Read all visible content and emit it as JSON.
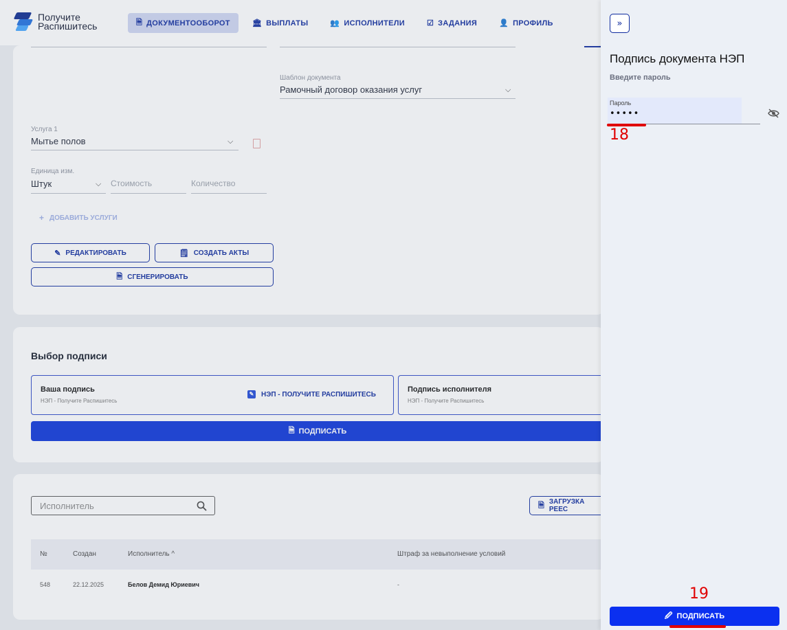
{
  "brand": {
    "line1": "Получите",
    "line2": "Распишитесь"
  },
  "nav": [
    {
      "label": "ДОКУМЕНТООБОРОТ",
      "icon": "document-icon",
      "active": true
    },
    {
      "label": "ВЫПЛАТЫ",
      "icon": "bank-icon",
      "active": false
    },
    {
      "label": "ИСПОЛНИТЕЛИ",
      "icon": "users-icon",
      "active": false
    },
    {
      "label": "ЗАДАНИЯ",
      "icon": "task-icon",
      "active": false
    },
    {
      "label": "ПРОФИЛЬ",
      "icon": "user-icon",
      "active": false
    }
  ],
  "form": {
    "template_label": "Шаблон документа",
    "template_value": "Рамочный договор оказания услуг",
    "service_label": "Услуга 1",
    "service_value": "Мытье полов",
    "unit_label": "Единица изм.",
    "unit_value": "Штук",
    "cost_placeholder": "Стоимость",
    "qty_placeholder": "Количество",
    "add_service": "ДОБАВИТЬ УСЛУГИ",
    "edit_button": "РЕДАКТИРОВАТЬ",
    "create_acts_button": "СОЗДАТЬ АКТЫ",
    "generate_button": "СГЕНЕРИРОВАТЬ"
  },
  "signature": {
    "title": "Выбор подписи",
    "your_sign_title": "Ваша подпись",
    "your_sign_sub": "НЭП - Получите Распишитесь",
    "method_label": "НЭП - ПОЛУЧИТЕ РАСПИШИТЕСЬ",
    "executor_sign_title": "Подпись исполнителя",
    "executor_sign_sub": "НЭП - Получите Распишитесь",
    "sign_button": "ПОДПИСАТЬ"
  },
  "executors": {
    "search_placeholder": "Исполнитель",
    "upload_button": "ЗАГРУЗКА РЕЕС",
    "columns": [
      "№",
      "Создан",
      "Исполнитель ^",
      "Штраф за невыполнение условий"
    ],
    "rows": [
      {
        "num": "548",
        "created": "22.12.2025",
        "executor": "Белов Демид Юриевич",
        "penalty": "-"
      }
    ]
  },
  "drawer": {
    "collapse_symbol": "»",
    "title": "Подпись документа НЭП",
    "subtitle": "Введите пароль",
    "password_label": "Пароль",
    "password_value": "•••••",
    "sign_button": "ПОДПИСАТЬ"
  },
  "annotations": {
    "mark1": "18",
    "mark2": "19",
    "color": "#e00000"
  }
}
